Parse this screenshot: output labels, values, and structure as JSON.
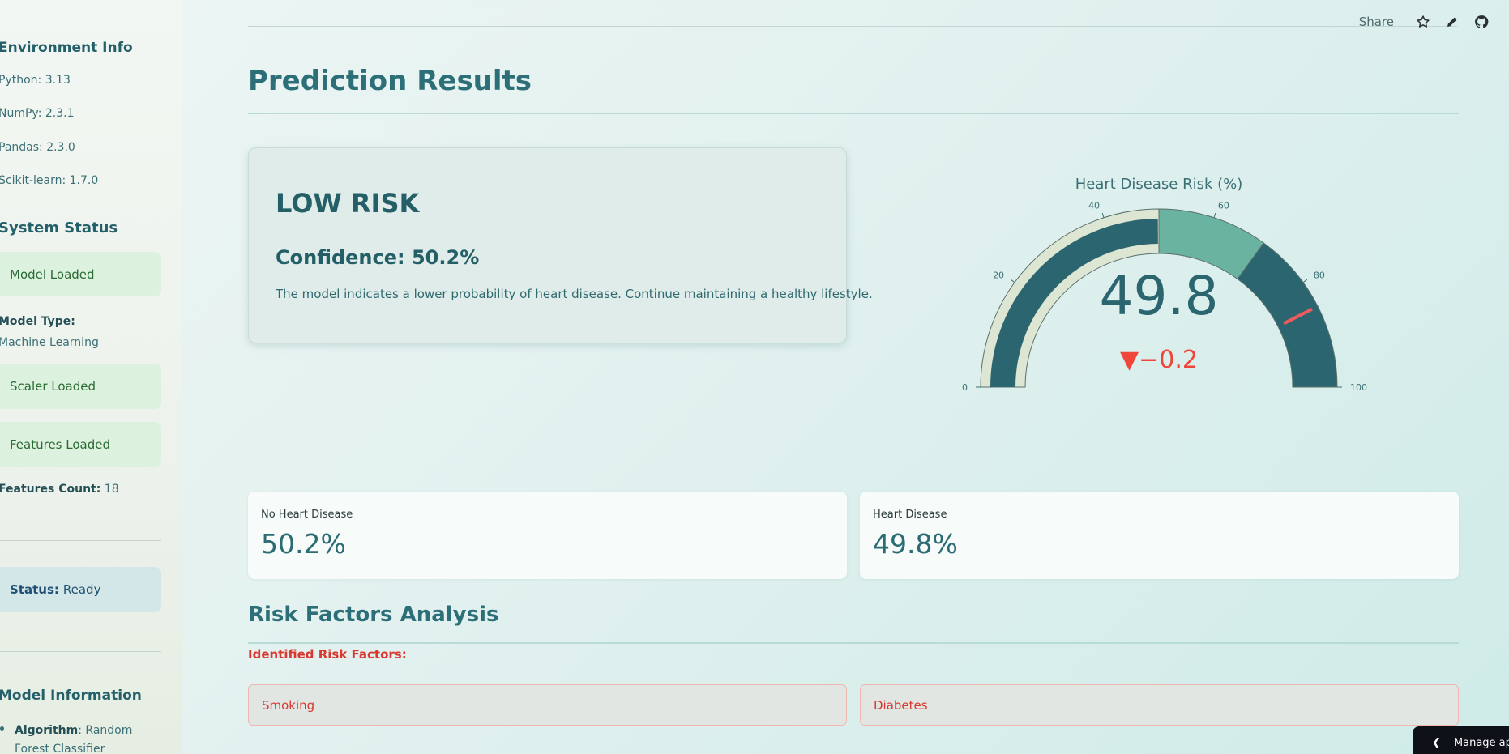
{
  "sidebar": {
    "env_title": "Environment Info",
    "env": [
      "Python: 3.13",
      "NumPy: 2.3.1",
      "Pandas: 2.3.0",
      "Scikit-learn: 1.7.0"
    ],
    "status_title": "System Status",
    "model_loaded": "Model Loaded",
    "model_type_label": "Model Type:",
    "model_type_value": "Machine Learning",
    "scaler_loaded": "Scaler Loaded",
    "features_loaded": "Features Loaded",
    "features_count_label": "Features Count:",
    "features_count_value": "18",
    "status_label": "Status:",
    "status_value": "Ready",
    "model_info_title": "Model Information",
    "algorithm_label": "Algorithm",
    "algorithm_value": ": Random Forest Classifier"
  },
  "toolbar": {
    "share_label": "Share",
    "icons": [
      "star-icon",
      "pencil-icon",
      "github-icon"
    ]
  },
  "main": {
    "title": "Prediction Results",
    "risk_level": "LOW RISK",
    "confidence": "Confidence: 50.2%",
    "message": "The model indicates a lower probability of heart disease. Continue maintaining a healthy lifestyle."
  },
  "gauge": {
    "title": "Heart Disease Risk (%)",
    "value": 49.8,
    "value_text": "49.8",
    "delta_text": "▼−0.2",
    "range": [
      0,
      100
    ],
    "ticks": [
      "0",
      "20",
      "40",
      "60",
      "80",
      "100"
    ],
    "steps": [
      {
        "from": 0,
        "to": 50,
        "color": "#dde6d3"
      },
      {
        "from": 50,
        "to": 70,
        "color": "#6ab3a0"
      },
      {
        "from": 70,
        "to": 100,
        "color": "#2b6670"
      }
    ],
    "bar_color": "#2b6670",
    "threshold": 85,
    "threshold_color": "#ec5c5f",
    "delta_color": "#f0453a"
  },
  "metrics": [
    {
      "label": "No Heart Disease",
      "value": "50.2%"
    },
    {
      "label": "Heart Disease",
      "value": "49.8%"
    }
  ],
  "risk_factors": {
    "title": "Risk Factors Analysis",
    "identified_label": "Identified Risk Factors:",
    "items": [
      "Smoking",
      "Diabetes"
    ]
  },
  "manage_app": {
    "label": "Manage app"
  }
}
